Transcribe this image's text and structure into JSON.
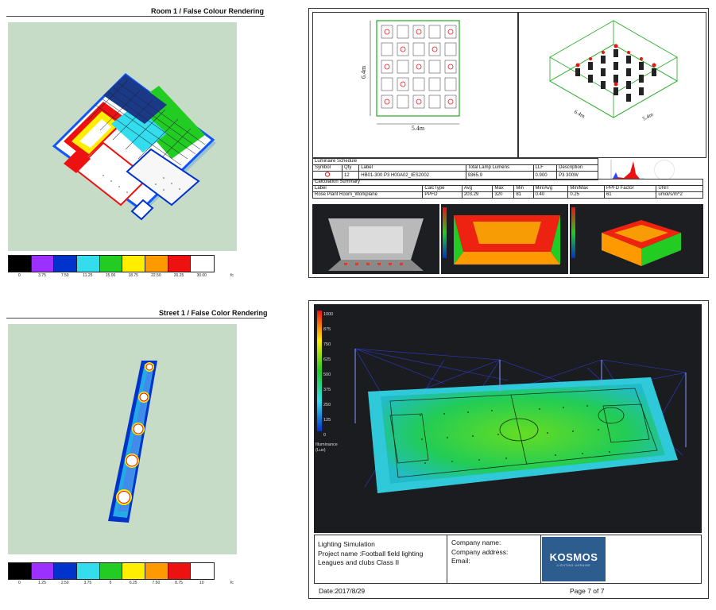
{
  "panel_top_left": {
    "title": "Room 1 / False Colour Rendering",
    "legend": {
      "colors": [
        "#000000",
        "#9b30ff",
        "#0033cc",
        "#33ddee",
        "#22cc22",
        "#ffee00",
        "#ff9900",
        "#ee1111",
        "#ffffff"
      ],
      "ticks": [
        "0",
        "3.75",
        "7.50",
        "11.25",
        "15.00",
        "18.75",
        "22.50",
        "26.25",
        "30.00"
      ],
      "unit": "fc"
    }
  },
  "panel_bottom_left": {
    "title": "Street 1 / False Color Rendering",
    "legend": {
      "colors": [
        "#000000",
        "#9b30ff",
        "#0033cc",
        "#33ddee",
        "#22cc22",
        "#ffee00",
        "#ff9900",
        "#ee1111",
        "#ffffff"
      ],
      "ticks": [
        "0",
        "1.25",
        "2.50",
        "3.75",
        "5",
        "6.25",
        "7.50",
        "8.75",
        "10"
      ],
      "unit": "fc"
    }
  },
  "panel_top_right": {
    "plan_dims": {
      "width": "5.4m",
      "height": "6.4m"
    },
    "iso_dims": {
      "a": "6.4m",
      "b": "5.4m"
    },
    "luminaire_schedule": {
      "title": "Luminaire Schedule",
      "headers": [
        "Symbol",
        "Qty",
        "Label",
        "Total Lamp Lumens",
        "LLF",
        "Description"
      ],
      "row": [
        "12",
        "HB01-300 P3 H00A02_IES2002",
        "9365.9",
        "0.900",
        "P3 300W"
      ]
    },
    "calc_summary": {
      "title": "Calculation Summary",
      "headers": [
        "Label",
        "CalcType",
        "Avg",
        "Max",
        "Min",
        "Min/Avg",
        "Min/Max",
        "PPFD Factor",
        "UNIT"
      ],
      "row": [
        "Rose Plant Room_Workplane",
        "PPFD",
        "203.29",
        "320",
        "81",
        "0.40",
        "0.25",
        "61",
        "umol/s/m^2"
      ]
    }
  },
  "panel_bottom_right": {
    "scale": {
      "ticks": [
        "1000",
        "875",
        "750",
        "625",
        "500",
        "375",
        "250",
        "125",
        "0"
      ],
      "label_line1": "Illuminance",
      "label_line2": "(Lux)"
    },
    "title_block": {
      "line1": "Lighting Simulation",
      "line2": "Project name :Football field lighting",
      "line3": "Leagues and clubs Class II",
      "company_name": "Company name:",
      "company_address": "Company address:",
      "email": "Email:",
      "logo_main": "KOSMOS",
      "logo_sub": "LIGHTING UKRAINE",
      "date": "Date:2017/8/29",
      "page": "Page 7 of 7"
    }
  },
  "colors": {
    "plot_background": "#c6dcc6",
    "dark_render_background": "#1c1e22",
    "logo_background": "#2d5c8f"
  }
}
